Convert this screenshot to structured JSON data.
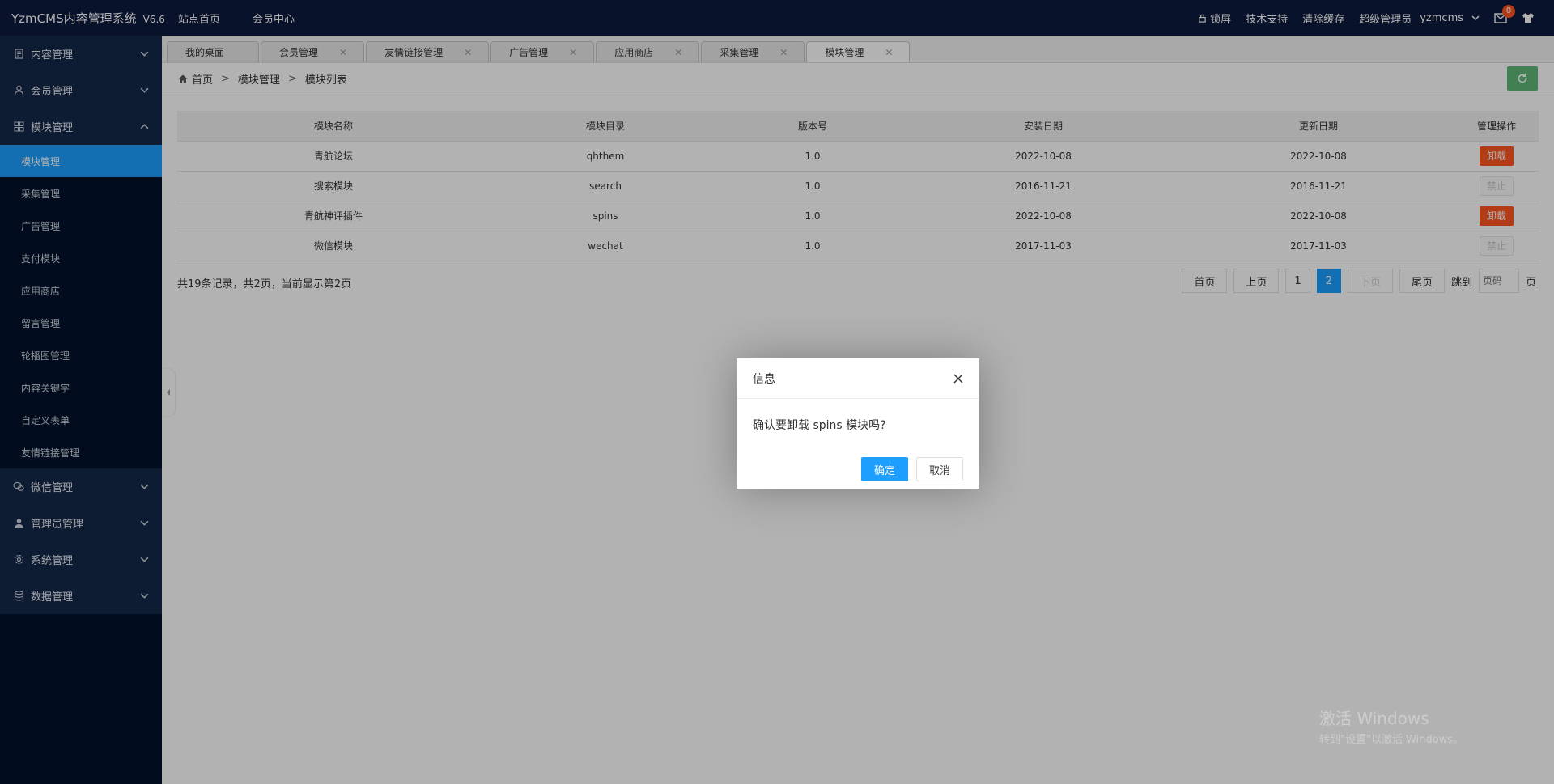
{
  "header": {
    "title": "YzmCMS内容管理系统",
    "version": "V6.6",
    "nav": [
      "站点首页",
      "会员中心"
    ],
    "lock": "锁屏",
    "support": "技术支持",
    "clear_cache": "清除缓存",
    "role": "超级管理员",
    "user": "yzmcms",
    "mail_badge": "0"
  },
  "sidebar": {
    "groups_top": [
      {
        "label": "内容管理",
        "icon": "document-icon"
      },
      {
        "label": "会员管理",
        "icon": "user-icon"
      },
      {
        "label": "模块管理",
        "icon": "grid-icon"
      }
    ],
    "module_items": [
      "模块管理",
      "采集管理",
      "广告管理",
      "支付模块",
      "应用商店",
      "留言管理",
      "轮播图管理",
      "内容关键字",
      "自定义表单",
      "友情链接管理"
    ],
    "groups_bottom": [
      {
        "label": "微信管理",
        "icon": "wechat-icon"
      },
      {
        "label": "管理员管理",
        "icon": "admin-icon"
      },
      {
        "label": "系统管理",
        "icon": "gear-icon"
      },
      {
        "label": "数据管理",
        "icon": "database-icon"
      }
    ]
  },
  "tabs": [
    "我的桌面",
    "会员管理",
    "友情链接管理",
    "广告管理",
    "应用商店",
    "采集管理",
    "模块管理"
  ],
  "breadcrumb": {
    "home": "首页",
    "level1": "模块管理",
    "level2": "模块列表",
    "sep": ">"
  },
  "table": {
    "headers": [
      "模块名称",
      "模块目录",
      "版本号",
      "安装日期",
      "更新日期",
      "管理操作"
    ],
    "rows": [
      {
        "name": "青航论坛",
        "dir": "qhthem",
        "ver": "1.0",
        "install": "2022-10-08",
        "update": "2022-10-08",
        "action": "卸载"
      },
      {
        "name": "搜索模块",
        "dir": "search",
        "ver": "1.0",
        "install": "2016-11-21",
        "update": "2016-11-21",
        "action": "禁止"
      },
      {
        "name": "青航神评插件",
        "dir": "spins",
        "ver": "1.0",
        "install": "2022-10-08",
        "update": "2022-10-08",
        "action": "卸载"
      },
      {
        "name": "微信模块",
        "dir": "wechat",
        "ver": "1.0",
        "install": "2017-11-03",
        "update": "2017-11-03",
        "action": "禁止"
      }
    ]
  },
  "pagination": {
    "info": "共19条记录，共2页，当前显示第2页",
    "first": "首页",
    "prev": "上页",
    "p1": "1",
    "p2": "2",
    "next": "下页",
    "last": "尾页",
    "jump": "跳到",
    "placeholder": "页码",
    "page_suffix": "页"
  },
  "dialog": {
    "title": "信息",
    "message": "确认要卸载 spins 模块吗?",
    "ok": "确定",
    "cancel": "取消"
  },
  "watermark": {
    "line1": "激活 Windows",
    "line2": "转到\"设置\"以激活 Windows。"
  }
}
